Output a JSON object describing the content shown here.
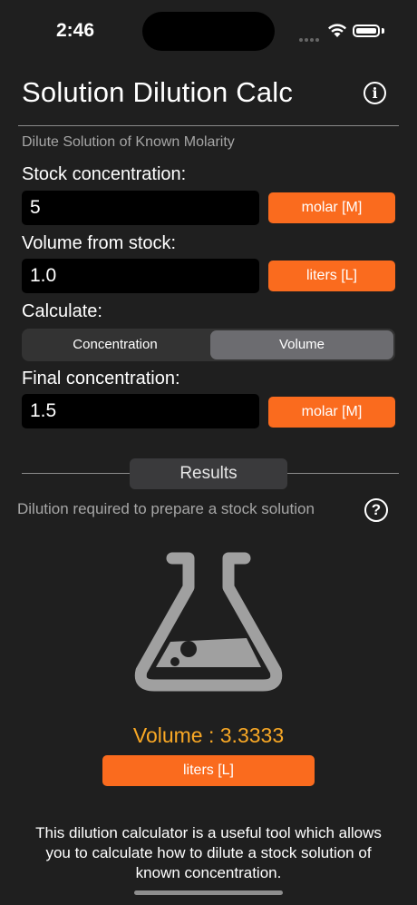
{
  "status_bar": {
    "time": "2:46"
  },
  "header": {
    "title": "Solution Dilution Calc",
    "info_icon": "info-circle-icon"
  },
  "subtitle": "Dilute Solution of Known Molarity",
  "stock": {
    "label": "Stock concentration:",
    "value": "5",
    "unit": "molar [M]"
  },
  "volume": {
    "label": "Volume from stock:",
    "value": "1.0",
    "unit": "liters [L]"
  },
  "calculate": {
    "label": "Calculate:",
    "options": [
      "Concentration",
      "Volume"
    ],
    "selected": "Volume"
  },
  "final": {
    "label": "Final concentration:",
    "value": "1.5",
    "unit": "molar [M]"
  },
  "results": {
    "header": "Results",
    "description": "Dilution required to prepare a stock solution",
    "help_icon": "question-circle-icon",
    "value_text": "Volume : 3.3333",
    "unit": "liters [L]"
  },
  "footer": "This dilution calculator is a useful tool which allows you to calculate how to dilute a stock solution of known concentration.",
  "colors": {
    "accent": "#fa6b1e",
    "result": "#f9a825",
    "background": "#1f1f1f"
  }
}
